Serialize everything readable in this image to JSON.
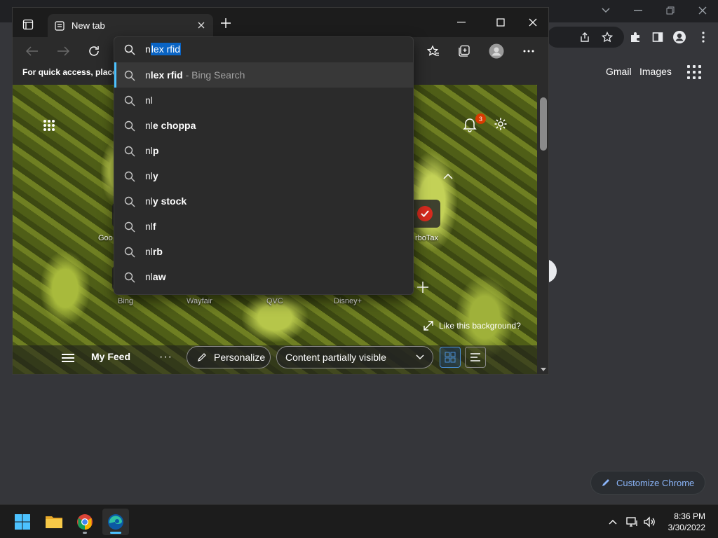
{
  "chrome": {
    "gmail_label": "Gmail",
    "images_label": "Images",
    "customize_label": "Customize Chrome"
  },
  "edge": {
    "tab_title": "New tab",
    "favorites_hint": "For quick access, place y",
    "omnibox": {
      "typed_prefix": "n",
      "selected_completion": "lex rfid"
    },
    "suggestions": [
      {
        "prefix": "n",
        "bold": "lex rfid",
        "hint": " - Bing Search",
        "active": true
      },
      {
        "prefix": "nl",
        "bold": "",
        "hint": "",
        "active": false
      },
      {
        "prefix": "nl",
        "bold": "e choppa",
        "hint": "",
        "active": false
      },
      {
        "prefix": "nl",
        "bold": "p",
        "hint": "",
        "active": false
      },
      {
        "prefix": "nl",
        "bold": "y",
        "hint": "",
        "active": false
      },
      {
        "prefix": "nl",
        "bold": "y stock",
        "hint": "",
        "active": false
      },
      {
        "prefix": "nl",
        "bold": "f",
        "hint": "",
        "active": false
      },
      {
        "prefix": "nl",
        "bold": "rb",
        "hint": "",
        "active": false
      },
      {
        "prefix": "nl",
        "bold": "aw",
        "hint": "",
        "active": false
      }
    ],
    "notification_count": "3",
    "sites": {
      "google_partial": "Goo",
      "turbotax_partial": "rboTax",
      "bing": "Bing",
      "wayfair": "Wayfair",
      "qvc": "QVC",
      "disney": "Disney+"
    },
    "like_background": "Like this background?",
    "feed": {
      "my_feed": "My Feed",
      "more": "···",
      "personalize": "Personalize",
      "content_visibility": "Content partially visible"
    }
  },
  "taskbar": {
    "time": "8:36 PM",
    "date": "3/30/2022"
  },
  "colors": {
    "accent": "#4cc2ff",
    "selection": "#0a64c4",
    "badge": "#d83b01",
    "chrome_link": "#8ab4f8"
  }
}
